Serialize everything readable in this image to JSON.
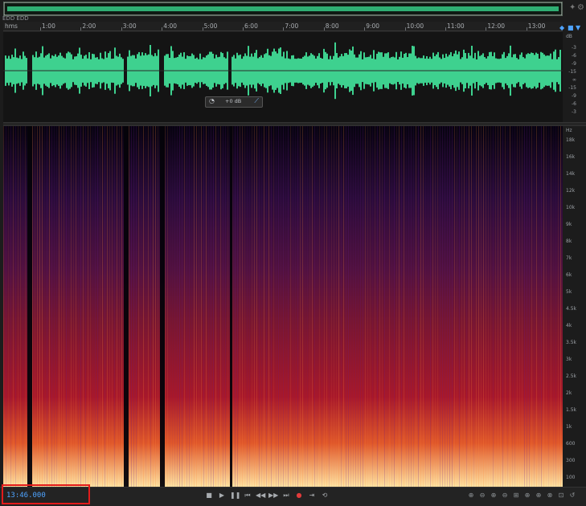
{
  "overview": {
    "label": "EDD EDD"
  },
  "ruler": {
    "unit": "hms",
    "ticks": [
      "1:00",
      "2:00",
      "3:00",
      "4:00",
      "5:00",
      "6:00",
      "7:00",
      "8:00",
      "9:00",
      "10:00",
      "11:00",
      "12:00",
      "13:00"
    ]
  },
  "waveform": {
    "color": "#3ed18f",
    "db_header": "dB",
    "db_labels": [
      "-3",
      "-6",
      "-9",
      "-15",
      "∞",
      "-15",
      "-9",
      "-6",
      "-3"
    ],
    "hud": {
      "value": "+0 dB"
    }
  },
  "spectral": {
    "hz_header": "Hz",
    "hz_labels": [
      "18k",
      "16k",
      "14k",
      "12k",
      "10k",
      "9k",
      "8k",
      "7k",
      "6k",
      "5k",
      "4.5k",
      "4k",
      "3.5k",
      "3k",
      "2.5k",
      "2k",
      "1.5k",
      "1k",
      "600",
      "300",
      "100"
    ]
  },
  "transport": {
    "time": "13:46.000",
    "controls": [
      {
        "name": "stop-button",
        "glyph": "■"
      },
      {
        "name": "play-button",
        "glyph": "▶"
      },
      {
        "name": "pause-button",
        "glyph": "❚❚"
      },
      {
        "name": "go-to-start-button",
        "glyph": "⏮"
      },
      {
        "name": "rewind-button",
        "glyph": "◀◀"
      },
      {
        "name": "fast-forward-button",
        "glyph": "▶▶"
      },
      {
        "name": "go-to-end-button",
        "glyph": "⏭"
      },
      {
        "name": "record-button",
        "glyph": "●"
      },
      {
        "name": "skip-selection-button",
        "glyph": "⇥"
      },
      {
        "name": "loop-button",
        "glyph": "⟲"
      }
    ],
    "record_color": "#e23b3b"
  },
  "zoom_controls": [
    {
      "name": "zoom-in-amplitude-button",
      "glyph": "⊕"
    },
    {
      "name": "zoom-out-amplitude-button",
      "glyph": "⊖"
    },
    {
      "name": "zoom-in-time-button",
      "glyph": "⊕"
    },
    {
      "name": "zoom-out-time-button",
      "glyph": "⊖"
    },
    {
      "name": "zoom-selection-button",
      "glyph": "⊞"
    },
    {
      "name": "zoom-in-left-button",
      "glyph": "⊕"
    },
    {
      "name": "zoom-in-right-button",
      "glyph": "⊕"
    },
    {
      "name": "zoom-out-full-button",
      "glyph": "⊗"
    },
    {
      "name": "zoom-fit-button",
      "glyph": "⊡"
    },
    {
      "name": "zoom-reset-button",
      "glyph": "↺"
    }
  ]
}
